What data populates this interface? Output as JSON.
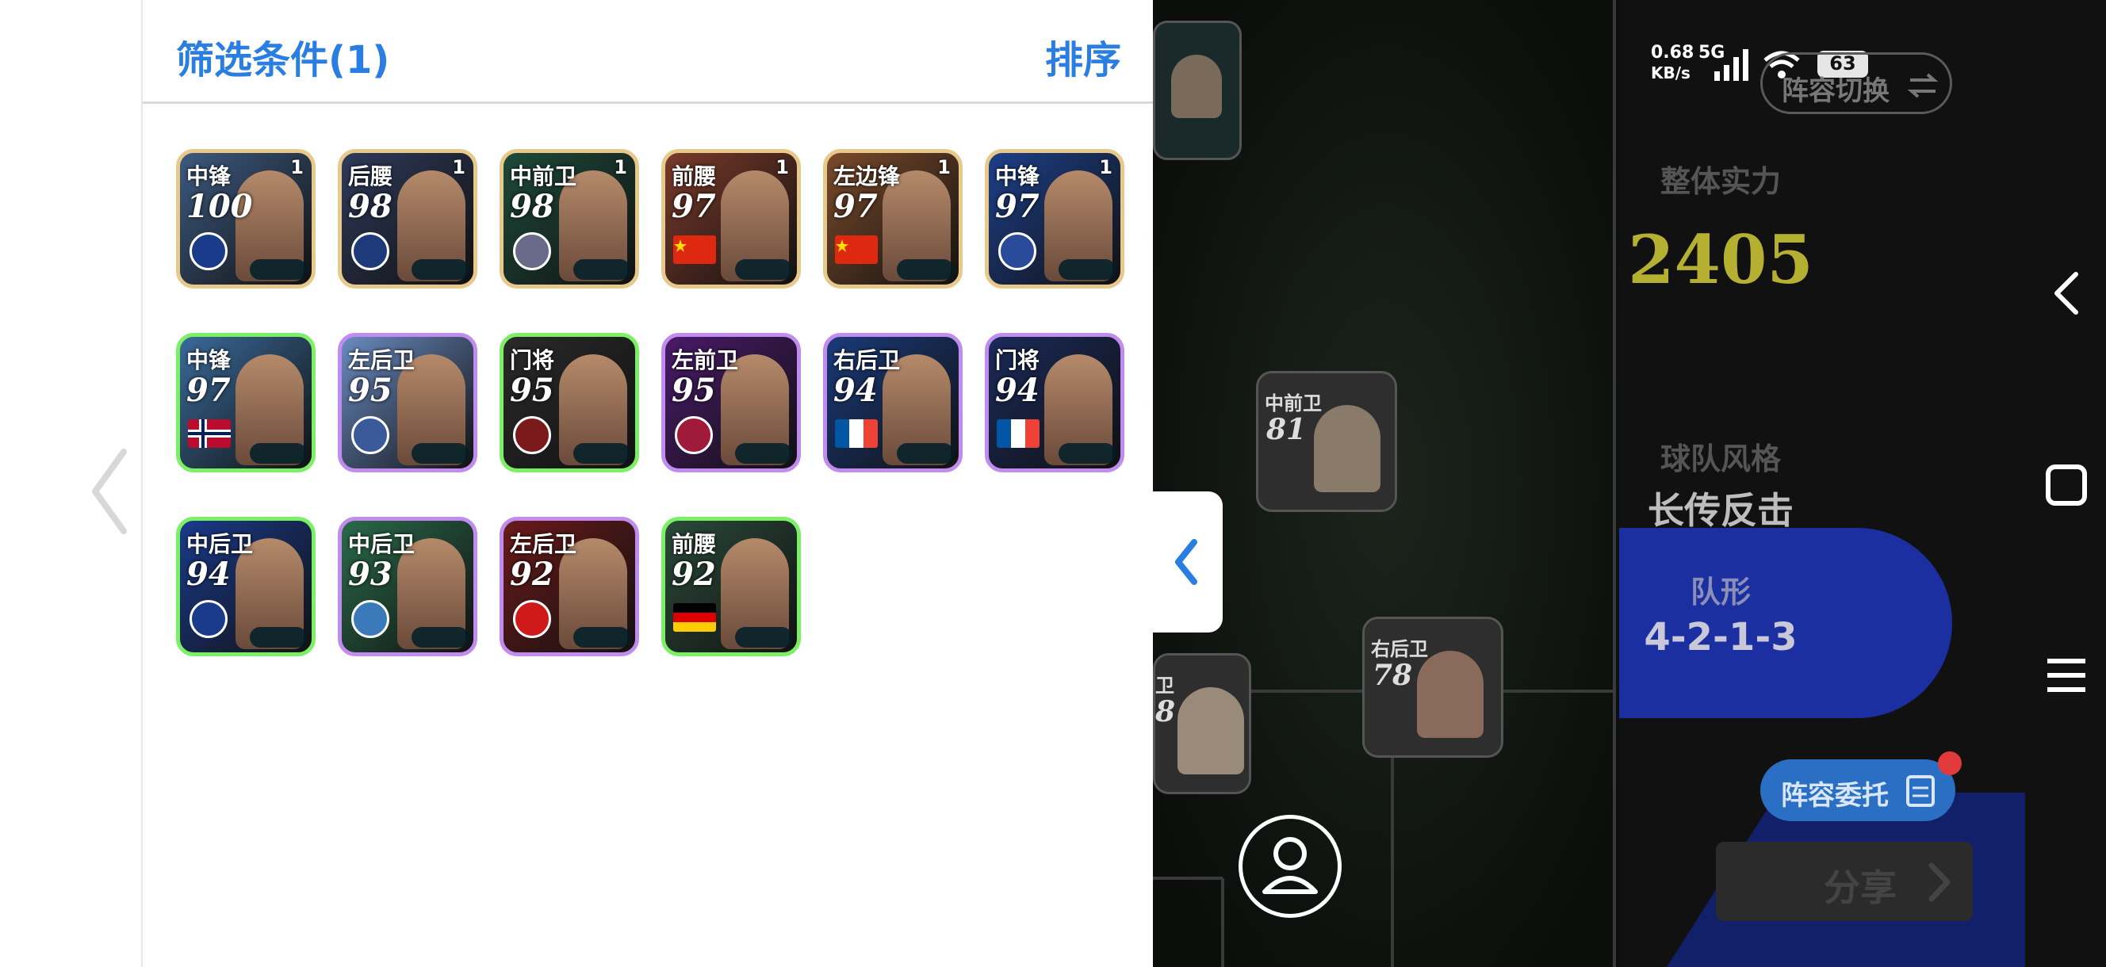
{
  "header": {
    "filter_title": "筛选条件(1)",
    "sort_label": "排序"
  },
  "colors": {
    "accent": "#2a7de1",
    "rating_gold": "#b5b032",
    "team_panel_blue": "#1b2fa0"
  },
  "cards": [
    {
      "position": "中锋",
      "rating": "100",
      "count": "1",
      "frame": "gold",
      "bg": "#3d5a80",
      "marker": "club",
      "marker_color": "#1a3a8a"
    },
    {
      "position": "后腰",
      "rating": "98",
      "count": "1",
      "frame": "gold",
      "bg": "#2e3a5a",
      "marker": "club",
      "marker_color": "#1d3b7a"
    },
    {
      "position": "中前卫",
      "rating": "98",
      "count": "1",
      "frame": "gold",
      "bg": "#1e4a3a",
      "marker": "club",
      "marker_color": "#6a6a8a"
    },
    {
      "position": "前腰",
      "rating": "97",
      "count": "1",
      "frame": "gold",
      "bg": "#7a3a2a",
      "marker": "flag",
      "flag": "cn"
    },
    {
      "position": "左边锋",
      "rating": "97",
      "count": "1",
      "frame": "gold",
      "bg": "#7a4a2a",
      "marker": "flag",
      "flag": "cn"
    },
    {
      "position": "中锋",
      "rating": "97",
      "count": "1",
      "frame": "gold",
      "bg": "#1d3f8a",
      "marker": "club",
      "marker_color": "#2a4a9a"
    },
    {
      "position": "中锋",
      "rating": "97",
      "count": "",
      "frame": "green",
      "bg": "#3a6a9a",
      "marker": "flag",
      "flag": "no"
    },
    {
      "position": "左后卫",
      "rating": "95",
      "count": "",
      "frame": "purple",
      "bg": "#6a8ac0",
      "marker": "club",
      "marker_color": "#3a5a9a"
    },
    {
      "position": "门将",
      "rating": "95",
      "count": "",
      "frame": "green",
      "bg": "#2a2a2a",
      "marker": "club",
      "marker_color": "#7a1a1a"
    },
    {
      "position": "左前卫",
      "rating": "95",
      "count": "",
      "frame": "purple",
      "bg": "#4a1a6a",
      "marker": "club",
      "marker_color": "#a01a3a"
    },
    {
      "position": "右后卫",
      "rating": "94",
      "count": "",
      "frame": "purple",
      "bg": "#1a3a7a",
      "marker": "flag",
      "flag": "fr"
    },
    {
      "position": "门将",
      "rating": "94",
      "count": "",
      "frame": "purple",
      "bg": "#1a2a5a",
      "marker": "flag",
      "flag": "fr"
    },
    {
      "position": "中后卫",
      "rating": "94",
      "count": "",
      "frame": "green",
      "bg": "#1a3a8a",
      "marker": "club",
      "marker_color": "#1a3a8a"
    },
    {
      "position": "中后卫",
      "rating": "93",
      "count": "",
      "frame": "purple",
      "bg": "#2a6a4a",
      "marker": "club",
      "marker_color": "#3a7aba"
    },
    {
      "position": "左后卫",
      "rating": "92",
      "count": "",
      "frame": "purple",
      "bg": "#6a1a1a",
      "marker": "club",
      "marker_color": "#d01a1a"
    },
    {
      "position": "前腰",
      "rating": "92",
      "count": "",
      "frame": "green",
      "bg": "#2a4a3a",
      "marker": "flag",
      "flag": "de"
    }
  ],
  "pitch": {
    "players": [
      {
        "position": "中前卫",
        "rating": "81"
      },
      {
        "position": "右后卫",
        "rating": "78"
      },
      {
        "position": "卫",
        "rating": "8"
      },
      {
        "position": "",
        "rating": ""
      }
    ]
  },
  "status_bar": {
    "speed": "0.68",
    "speed_unit": "KB/s",
    "network": "5G",
    "battery": "63"
  },
  "team_panel": {
    "switch_label": "阵容切换",
    "overall_label": "整体实力",
    "overall_value": "2405",
    "style_label": "球队风格",
    "style_value": "长传反击",
    "formation_label": "队形",
    "formation_value": "4-2-1-3",
    "delegate_label": "阵容委托",
    "share_label": "分享"
  }
}
